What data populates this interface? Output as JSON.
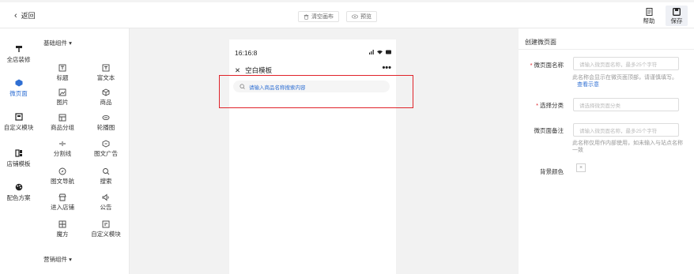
{
  "topbar": {
    "back_label": "返回",
    "clear_label": "清空画布",
    "preview_label": "预览",
    "help_label": "帮助",
    "save_label": "保存"
  },
  "leftnav": {
    "items": [
      {
        "label": "全店装修",
        "icon": "paint-roller-icon"
      },
      {
        "label": "微页面",
        "icon": "page-icon",
        "active": true
      },
      {
        "label": "自定义模块",
        "icon": "custom-module-icon"
      },
      {
        "label": "店铺模板",
        "icon": "template-icon"
      },
      {
        "label": "配色方案",
        "icon": "palette-icon"
      }
    ]
  },
  "components": {
    "basic_group": "基础组件",
    "marketing_group": "营销组件",
    "items": [
      {
        "label": "标题",
        "icon": "title-icon"
      },
      {
        "label": "富文本",
        "icon": "rich-text-icon"
      },
      {
        "label": "图片",
        "icon": "image-icon"
      },
      {
        "label": "商品",
        "icon": "product-icon"
      },
      {
        "label": "商品分组",
        "icon": "product-group-icon"
      },
      {
        "label": "轮播图",
        "icon": "carousel-icon"
      },
      {
        "label": "分割线",
        "icon": "divider-icon"
      },
      {
        "label": "图文广告",
        "icon": "image-ad-icon"
      },
      {
        "label": "图文导航",
        "icon": "image-nav-icon"
      },
      {
        "label": "搜索",
        "icon": "search-icon"
      },
      {
        "label": "进入店铺",
        "icon": "enter-store-icon"
      },
      {
        "label": "公告",
        "icon": "announcement-icon"
      },
      {
        "label": "魔方",
        "icon": "cube-icon"
      },
      {
        "label": "自定义模块",
        "icon": "custom-module-icon"
      }
    ]
  },
  "phone": {
    "time": "16:16:8",
    "title": "空白模板",
    "search_placeholder": "请输入商品名称搜索内容"
  },
  "form": {
    "header": "创建微页面",
    "name_label": "微页面名称",
    "name_placeholder": "请输入微页面名称，最多25个字符",
    "name_hint": "此名称会显示在微页面顶部，请谨慎填写。",
    "name_hint_link": "查看示意",
    "category_label": "选择分类",
    "category_placeholder": "请选择微页面分类",
    "remark_label": "微页面备注",
    "remark_placeholder": "请输入微页面名称，最多25个字符",
    "remark_hint": "此名称仅用作内部使用，如未输入与站点名称一致",
    "bg_color_label": "背景颜色",
    "bg_color_value": "×"
  },
  "colors": {
    "accent": "#2f6fd3",
    "required": "#e0232a",
    "highlight_border": "#e0232a",
    "canvas_bg": "#f2f2f2"
  }
}
